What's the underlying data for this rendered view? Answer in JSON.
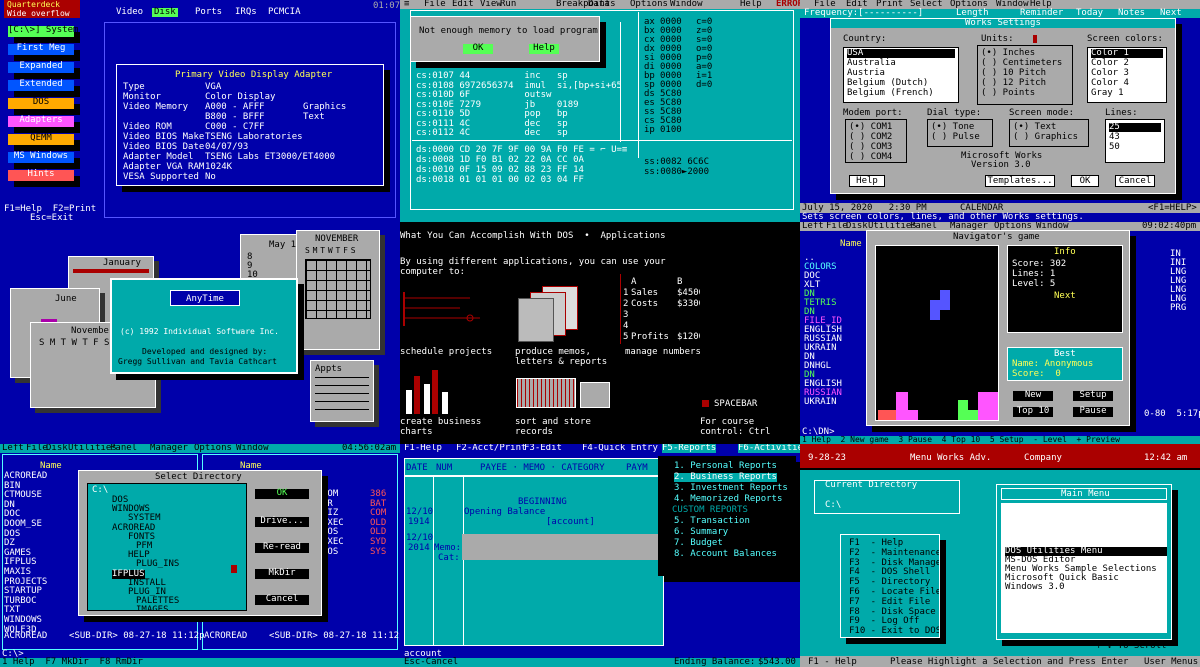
{
  "p1": {
    "title": "Quarterdeck",
    "subtitle": "Wide overflow",
    "menu": [
      "Video",
      "Disk",
      "Ports",
      "IRQs",
      "PCMCIA"
    ],
    "clock": "01:07",
    "items": [
      "[C:\\>] System",
      "First Meg",
      "Expanded",
      "Extended",
      "DOS",
      "Adapters",
      "QEMM",
      "MS Windows",
      "Hints"
    ],
    "panel_title": "Primary Video Display Adapter",
    "rows": [
      [
        "Type",
        "VGA",
        ""
      ],
      [
        "Monitor",
        "Color Display",
        ""
      ],
      [
        "Video Memory",
        "A000 - AFFF",
        "Graphics"
      ],
      [
        "",
        "B800 - BFFF",
        "Text"
      ],
      [
        "Video ROM",
        "C000 - C7FF",
        ""
      ],
      [
        "Video BIOS Make",
        "TSENG Laboratories",
        ""
      ],
      [
        "Video BIOS Date",
        "04/07/93",
        ""
      ],
      [
        "Adapter Model",
        "TSENG Labs ET3000/ET4000",
        ""
      ],
      [
        "Adapter VGA RAM",
        "1024K",
        ""
      ],
      [
        "VESA Supported",
        "No",
        ""
      ]
    ],
    "footer1": "F1=Help  F2=Print",
    "footer2": "Esc=Exit"
  },
  "p2": {
    "menu": [
      "≡",
      "File",
      "Edit",
      "View",
      "Run",
      "Breakpoints",
      "Data",
      "Options",
      "Window",
      "Help"
    ],
    "status": "ERROR",
    "dialog_msg": "Not enough memory to load program",
    "ok": "OK",
    "help": "Help",
    "code": [
      "cs:0107 44          inc   sp",
      "cs:0108 6972656374  imul  si,[bp+si+65]",
      "cs:010D 6F          outsw",
      "cs:010E 7279        jb    0189",
      "cs:0110 5D          pop   bp",
      "cs:0111 4C          dec   sp",
      "cs:0112 4C          dec   sp"
    ],
    "regs": [
      [
        "ax",
        "0000"
      ],
      [
        "bx",
        "0000"
      ],
      [
        "cx",
        "0000"
      ],
      [
        "dx",
        "0000"
      ],
      [
        "si",
        "0000"
      ],
      [
        "di",
        "0000"
      ],
      [
        "bp",
        "0000"
      ],
      [
        "sp",
        "0000"
      ],
      [
        "ds",
        "5C80"
      ],
      [
        "es",
        "5C80"
      ],
      [
        "ss",
        "5C80"
      ],
      [
        "cs",
        "5C80"
      ],
      [
        "ip",
        "0100"
      ]
    ],
    "flags": [
      "c=0",
      "z=0",
      "s=0",
      "o=0",
      "p=0",
      "a=0",
      "i=1",
      "d=0"
    ],
    "dump": [
      "ds:0000 CD 20 7F 9F 00 9A F0 FE = ⌐ U=≡",
      "ds:0008 1D F0 B1 02 22 0A CC 0A",
      "ds:0010 0F 15 09 02 88 23 FF 14",
      "ds:0018 01 01 01 00 02 03 04 FF"
    ],
    "stack": [
      "ss:0082 6C6C",
      "ss:0080►2000"
    ]
  },
  "p3": {
    "menu": [
      "File",
      "Edit",
      "Print",
      "Select",
      "Options",
      "Window",
      "Help"
    ],
    "bar": [
      "Frequency:[----------]",
      "Length",
      "Reminder",
      "Today",
      "Notes",
      "Next"
    ],
    "title": "Works Settings",
    "country_lbl": "Country:",
    "countries": [
      "USA",
      "Australia",
      "Austria",
      "Belgium (Dutch)",
      "Belgium (French)"
    ],
    "units_lbl": "Units:",
    "units": [
      "(•) Inches",
      "( ) Centimeters",
      "( ) 10 Pitch",
      "( ) 12 Pitch",
      "( ) Points"
    ],
    "screen_lbl": "Screen colors:",
    "colors": [
      "Color 1",
      "Color 2",
      "Color 3",
      "Color 4",
      "Gray 1"
    ],
    "modem_lbl": "Modem port:",
    "modem": [
      "(•) COM1",
      "( ) COM2",
      "( ) COM3",
      "( ) COM4"
    ],
    "dial_lbl": "Dial type:",
    "dial": [
      "(•) Tone",
      "( ) Pulse"
    ],
    "mode_lbl": "Screen mode:",
    "mode": [
      "(•) Text",
      "( ) Graphics"
    ],
    "lines_lbl": "Lines:",
    "lines": [
      "25",
      "43",
      "50"
    ],
    "app": "Microsoft Works",
    "version": "Version 3.0",
    "btn_help": "Help",
    "btn_templates": "Templates...",
    "btn_ok": "OK",
    "btn_cancel": "Cancel",
    "status_date": "July 15, 2020   2:30 PM",
    "status_mid": "CALENDAR",
    "status_right": "<F1=HELP>",
    "status_line": "Sets screen colors, lines, and other Works settings."
  },
  "p4": {
    "cal1": "January",
    "cal2": "June",
    "cal3": "November",
    "cal4": "May 12",
    "cal5": "NOVEMBER",
    "days": "S M T W T F S",
    "title": "AnyTime",
    "copy": "(c) 1992 Individual Software Inc.",
    "dev": "Developed and designed by:",
    "names": "Gregg Sullivan and Tavia Cathcart",
    "appts": "Appts",
    "hours": [
      "8",
      "9",
      "10",
      "11",
      "12",
      "1",
      "2",
      "3",
      "4"
    ]
  },
  "p5": {
    "header": "What You Can Accomplish With DOS  •  Applications",
    "intro1": "By using different applications, you can use your",
    "intro2": "computer to:",
    "c1": "schedule projects",
    "c2a": "produce memos,",
    "c2b": "letters & reports",
    "c3": "manage numbers",
    "c4a": "create business",
    "c4b": "charts",
    "c5a": "sort and store",
    "c5b": "records",
    "sheet": [
      [
        "",
        "A",
        "B"
      ],
      [
        "1",
        "Sales",
        "$4500"
      ],
      [
        "2",
        "Costs",
        "$3300"
      ],
      [
        "3",
        "",
        ""
      ],
      [
        "4",
        "",
        ""
      ],
      [
        "5",
        "Profits",
        "$1200"
      ]
    ],
    "spacebar": "SPACEBAR",
    "more1": "For course",
    "more2": "control: Ctrl"
  },
  "p6": {
    "menu": [
      "Left",
      "File",
      "Disk",
      "Utilities",
      "Panel",
      "Manager",
      "Options",
      "Window"
    ],
    "clock": "09:02:40pm",
    "title": "Navigator's game",
    "col": "Name",
    "files": [
      "..",
      "COLORS",
      "DOC",
      "XLT",
      "DN",
      "TETRIS",
      "DN",
      "FILE_ID",
      "ENGLISH",
      "RUSSIAN",
      "UKRAIN",
      "DN",
      "DNHGL",
      "DN",
      "ENGLISH",
      "RUSSIAN",
      "UKRAIN"
    ],
    "right": [
      "IN",
      "INI",
      "LNG",
      "LNG",
      "LNG",
      "LNG",
      "PRG"
    ],
    "info": "Info",
    "score": "Score: 302",
    "lines": "Lines: 1",
    "level": "Level: 5",
    "next": "Next",
    "best": "Best",
    "best_name": "Name: Anonymous",
    "best_score": "Score:  0",
    "new": "New",
    "setup": "Setup",
    "top": "Top 10",
    "pause": "Pause",
    "prompt": "C:\\DN>",
    "bottom": "1 Help  2 New game  3 Pause  4 Top 10  5 Setup  - Level  + Preview",
    "tail": "0-80  5:17p"
  },
  "p7": {
    "menu": [
      "Left",
      "File",
      "Disk",
      "Utilities",
      "Panel",
      "Manager",
      "Options",
      "Window"
    ],
    "clock": "04:56:02am",
    "col": "Name",
    "left": [
      "ACROREAD",
      "BIN",
      "CTMOUSE",
      "DN",
      "DOC",
      "DOOM_SE",
      "DOS",
      "DZ",
      "GAMES",
      "IFPLUS",
      "MAXIS",
      "PROJECTS",
      "STARTUP",
      "TURBOC",
      "TXT",
      "WINDOWS",
      "WOLF3D"
    ],
    "title": "Select Directory",
    "path": "C:\\",
    "tree": [
      "DOS",
      "WINDOWS",
      "SYSTEM",
      "ACROREAD",
      "FONTS",
      "PFM",
      "HELP",
      "PLUG_INS",
      "IFPLUS",
      "INSTALL",
      "PLUG_IN",
      "PALETTES",
      "IMAGES"
    ],
    "ok": "OK",
    "drive": "Drive...",
    "reread": "Re-read",
    "mkdir": "MkDir",
    "cancel": "Cancel",
    "right": [
      [
        "COM",
        "386"
      ],
      [
        "DR",
        "BAT"
      ],
      [
        "RIZ",
        "COM"
      ],
      [
        "EXEC",
        "OLD"
      ],
      [
        "DOS",
        "OLD"
      ],
      [
        "EXEC",
        "SYD"
      ],
      [
        "DOS",
        "SYS"
      ]
    ],
    "foot_l": "ACROREAD    <SUB-DIR> 08-27-18 11:12p",
    "foot_r": "ACROREAD    <SUB-DIR> 08-27-18 11:12p",
    "prompt": "C:\\>",
    "bottom": "1 Help  F7 MkDir  F8 RmDir"
  },
  "p8": {
    "menu": [
      "F1-Help",
      "F2-Acct/Print",
      "F3-Edit",
      "F4-Quick Entry",
      "F5-Reports",
      "F6-Activities"
    ],
    "cols": [
      "DATE",
      "NUM",
      "PAYEE · MEMO · CATEGORY",
      "PAYM"
    ],
    "beginning": "BEGINNING",
    "date1": "12/10",
    "num1": "1914",
    "opening": "Opening Balance",
    "account": "[account]",
    "date2": "12/10",
    "num2": "2014",
    "memo": "Memo:",
    "cat": "Cat:",
    "reports": [
      "1. Personal Reports",
      "2. Business Reports",
      "3. Investment Reports",
      "4. Memorized Reports",
      "CUSTOM REPORTS",
      "5. Transaction",
      "6. Summary",
      "7. Budget",
      "8. Account Balances"
    ],
    "foot1": "account",
    "foot2": "Esc-Cancel",
    "balance_lbl": "Ending Balance:",
    "balance": "$543.00"
  },
  "p9": {
    "date": "9-28-23",
    "title": "Menu Works Adv.",
    "company": "Company",
    "time": "12:42 am",
    "curdir_lbl": "Current Directory",
    "curdir": "C:\\",
    "main": "Main Menu",
    "items": [
      "DOS Utilities Menu",
      "MS-DOS Editor",
      "Menu Works Sample Selections",
      "Microsoft Quick Basic",
      "Windows 3.0"
    ],
    "keys": [
      "F1  - Help",
      "F2  - Maintenance",
      "F3  - Disk Manager",
      "F4  - DOS Shell",
      "F5  - Directory",
      "F6  - Locate File",
      "F7  - Edit File",
      "F8  - Disk Space",
      "F9  - Log Off",
      "F10 - Exit to DOS"
    ],
    "scroll": "↑ ↓ To Scroll",
    "foot_l": "F1 - Help",
    "foot_m": "Please Highlight a Selection and Press Enter",
    "foot_r": "User Menus"
  }
}
